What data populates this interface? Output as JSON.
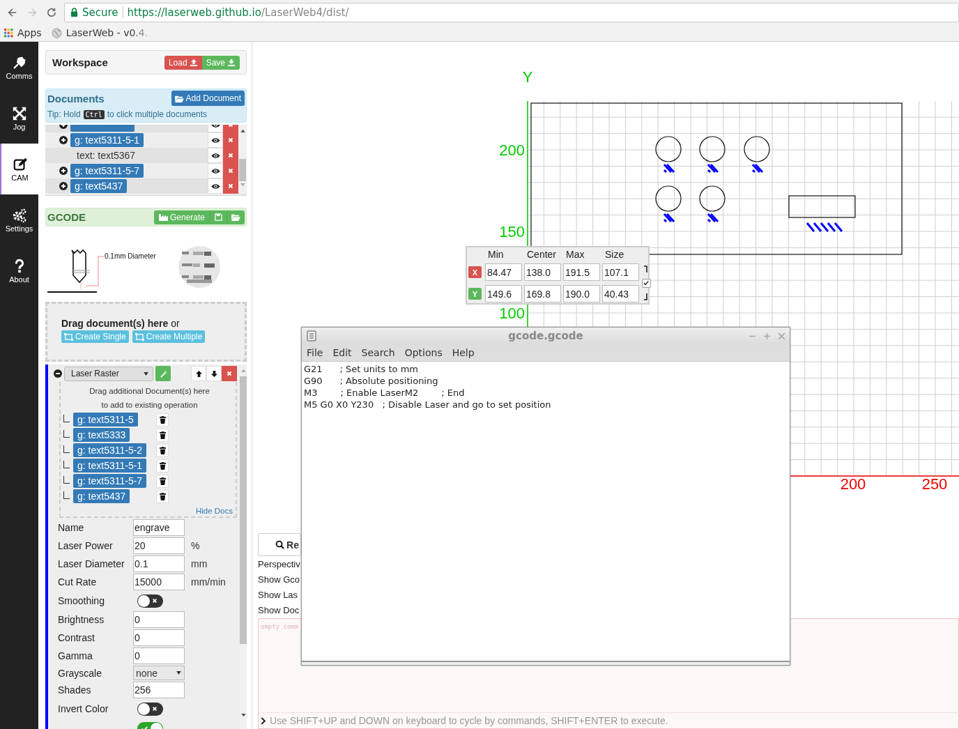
{
  "browser": {
    "secure_label": "Secure",
    "url_host": "https://laserweb.github.io",
    "url_path": "/LaserWeb4/dist/",
    "bookmarks": [
      {
        "kind": "apps",
        "label": "Apps"
      },
      {
        "kind": "site",
        "label": "LaserWeb - v0.4."
      }
    ]
  },
  "sidebar": {
    "items": [
      {
        "label": "Comms",
        "selected": false
      },
      {
        "label": "Jog",
        "selected": false
      },
      {
        "label": "CAM",
        "selected": true
      },
      {
        "label": "Settings",
        "selected": false
      },
      {
        "label": "About",
        "selected": false
      }
    ]
  },
  "workspace": {
    "title": "Workspace",
    "buttons": [
      {
        "kind": "load",
        "label": "Load"
      },
      {
        "kind": "save",
        "label": "Save"
      }
    ]
  },
  "documents": {
    "title": "Documents",
    "add_button": "Add Document",
    "tip_before": "Tip: Hold",
    "tip_key": "Ctrl",
    "tip_after": "to click multiple documents",
    "items": [
      {
        "kind": "group"
      },
      {
        "kind": "group",
        "label": "g: text5311-5-1"
      },
      {
        "kind": "text",
        "label": "text: text5367"
      },
      {
        "kind": "group",
        "label": "g: text5311-5-7"
      },
      {
        "kind": "group",
        "label": "g: text5437"
      }
    ]
  },
  "gcode": {
    "title": "GCODE",
    "generate_button": "Generate",
    "diagram_label": "0.1mm Diameter"
  },
  "drop_zone": {
    "text": "**Drag document(s) here** or",
    "buttons": [
      "Create Single",
      "Create Multiple"
    ]
  },
  "operation": {
    "expanded": true,
    "type": "Laser Raster",
    "drop_hint": [
      "Drag additional Document(s) here",
      "to add to existing operation"
    ],
    "documents": [
      "g: text5311-5",
      "g: text5333",
      "g: text5311-5-2",
      "g: text5311-5-1",
      "g: text5311-5-7",
      "g: text5437"
    ],
    "hide_docs": "Hide Docs",
    "fields": [
      {
        "kind": "input",
        "label": "Name",
        "value": "engrave"
      },
      {
        "kind": "input",
        "label": "Laser Power",
        "value": "20",
        "unit": "%"
      },
      {
        "kind": "input",
        "label": "Laser Diameter",
        "value": "0.1",
        "unit": "mm"
      },
      {
        "kind": "input",
        "label": "Cut Rate",
        "value": "15000",
        "unit": "mm/min"
      },
      {
        "kind": "toggle",
        "label": "Smoothing",
        "on": false
      },
      {
        "kind": "input",
        "label": "Brightness",
        "value": "0"
      },
      {
        "kind": "input",
        "label": "Contrast",
        "value": "0"
      },
      {
        "kind": "input",
        "label": "Gamma",
        "value": "0"
      },
      {
        "kind": "select",
        "label": "Grayscale",
        "value": "none"
      },
      {
        "kind": "input",
        "label": "Shades",
        "value": "256"
      },
      {
        "kind": "toggle",
        "label": "Invert Color",
        "on": false
      },
      {
        "kind": "toggle",
        "on": true
      }
    ]
  },
  "canvas": {
    "y_axis_label": "Y",
    "y_ticks": [
      "200",
      "150",
      "100"
    ],
    "x_ticks": [
      "200",
      "250"
    ]
  },
  "bounds": {
    "columns": [
      "Min",
      "Center",
      "Max",
      "Size"
    ],
    "rows": [
      {
        "axis": "X",
        "color": "#d9534f",
        "values": [
          "84.47",
          "138.0",
          "191.5",
          "107.1"
        ]
      },
      {
        "axis": "Y",
        "color": "#5cb85c",
        "values": [
          "149.6",
          "169.8",
          "190.0",
          "40.43"
        ]
      }
    ],
    "linked": true
  },
  "viewer_controls": {
    "reset_button": "Re",
    "options": [
      "Perspectiv",
      "Show Gco",
      "Show Las",
      "Show Doc"
    ]
  },
  "console": {
    "placeholder": "empty comm",
    "hint": "Use SHIFT+UP and DOWN on keyboard to cycle by commands, SHIFT+ENTER to execute."
  },
  "editor": {
    "title": "gcode.gcode",
    "menus": [
      "File",
      "Edit",
      "Search",
      "Options",
      "Help"
    ],
    "lines": [
      "G21      ; Set units to mm",
      "G90      ; Absolute positioning",
      "M3        ; Enable LaserM2        ; End",
      "M5 G0 X0 Y230   ; Disable Laser and go to set position"
    ]
  }
}
